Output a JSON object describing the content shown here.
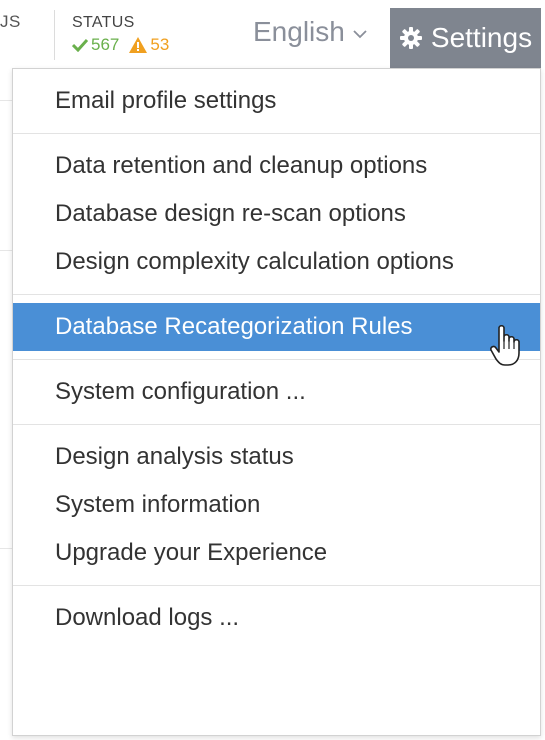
{
  "header": {
    "cut_text": "JS",
    "status": {
      "label": "STATUS",
      "ok_count": "567",
      "warn_count": "53",
      "ok_color": "#6ab04c",
      "warn_color": "#f0a020"
    },
    "language": {
      "selected": "English"
    },
    "settings_label": "Settings"
  },
  "menu": {
    "groups": [
      {
        "items": [
          "Email profile settings"
        ]
      },
      {
        "items": [
          "Data retention and cleanup options",
          "Database design re-scan options",
          "Design complexity calculation options"
        ]
      },
      {
        "items": [
          "Database Recategorization Rules"
        ]
      },
      {
        "items": [
          "System configuration ..."
        ]
      },
      {
        "items": [
          "Design analysis status",
          "System information",
          "Upgrade your Experience"
        ]
      },
      {
        "items": [
          "Download logs ..."
        ]
      }
    ],
    "highlighted_item": "Database Recategorization Rules",
    "highlight_color": "#4a8fd6"
  },
  "icons": {
    "ok": "check-icon",
    "warn": "warning-icon",
    "language": "chevron-down-icon",
    "settings": "gear-icon",
    "cursor": "hand-pointer-icon"
  }
}
